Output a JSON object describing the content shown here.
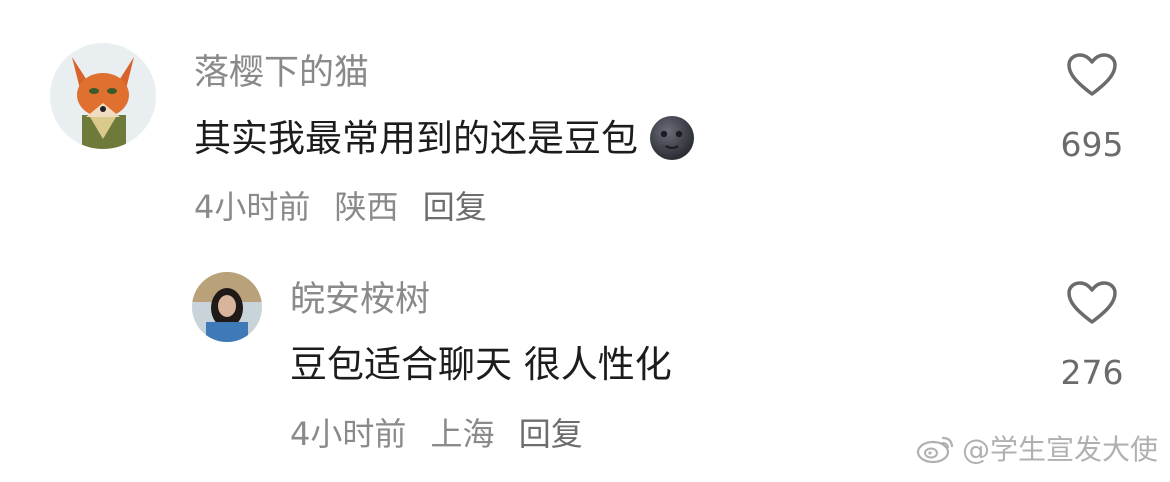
{
  "comments": [
    {
      "username": "落樱下的猫",
      "text": "其实我最常用到的还是豆包",
      "emoji": "new-moon-face",
      "time": "4小时前",
      "location": "陕西",
      "reply_label": "回复",
      "likes": "695"
    },
    {
      "username": "皖安桉树",
      "text": "豆包适合聊天 很人性化",
      "time": "4小时前",
      "location": "上海",
      "reply_label": "回复",
      "likes": "276"
    }
  ],
  "watermark": {
    "text": "@学生宣发大使",
    "icon": "weibo-icon"
  },
  "colors": {
    "username": "#8a8a8a",
    "text": "#1c1c1c",
    "meta": "#8a8a8a",
    "like_count": "#6b6b6b"
  }
}
